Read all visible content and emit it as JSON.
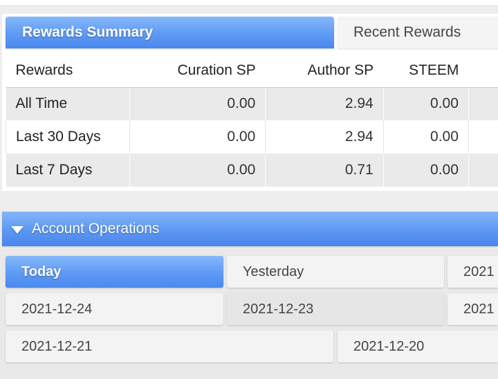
{
  "rewards": {
    "tabs": [
      {
        "label": "Rewards Summary",
        "active": true
      },
      {
        "label": "Recent Rewards",
        "active": false
      }
    ],
    "columns": [
      "Rewards",
      "Curation SP",
      "Author SP",
      "STEEM"
    ],
    "rows": [
      {
        "label": "All Time",
        "curation_sp": "0.00",
        "author_sp": "2.94",
        "steem": "0.00"
      },
      {
        "label": "Last 30 Days",
        "curation_sp": "0.00",
        "author_sp": "2.94",
        "steem": "0.00"
      },
      {
        "label": "Last 7 Days",
        "curation_sp": "0.00",
        "author_sp": "0.71",
        "steem": "0.00"
      }
    ]
  },
  "operations": {
    "title": "Account Operations",
    "days": [
      "Today",
      "Yesterday",
      "2021",
      "2021-12-24",
      "2021-12-23",
      "2021",
      "2021-12-21",
      "2021-12-20"
    ]
  },
  "colors": {
    "accent": "#5e9af4",
    "background": "#eeeeee"
  }
}
